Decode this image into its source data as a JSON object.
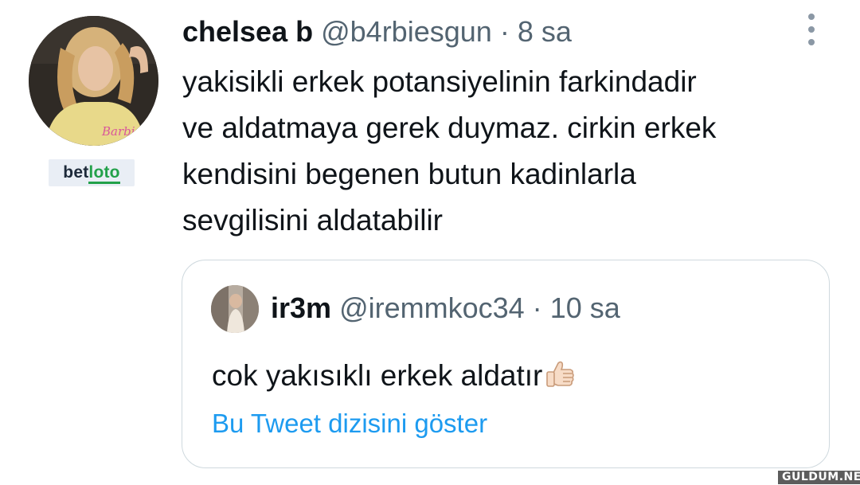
{
  "tweet": {
    "author_name": "chelsea b",
    "handle": "@b4rbiesgun",
    "separator": "·",
    "time": "8 sa",
    "text_lines": [
      "yakisikli erkek potansiyelinin farkindadir",
      "ve aldatmaya gerek duymaz. cirkin erkek",
      "kendisini begenen butun kadinlarla",
      "sevgilisini aldatabilir"
    ]
  },
  "quoted_tweet": {
    "author_name": "ir3m",
    "handle": "@iremmkoc34",
    "separator": "·",
    "time": "10 sa",
    "text": "cok yakısıklı erkek aldatır",
    "emoji": "thumbs-up-light-skin-tone",
    "show_thread_label": "Bu Tweet dizisini göster"
  },
  "watermarks": {
    "logo": "betloto",
    "site": "GULDUM.NET"
  },
  "icons": {
    "more": "more-vertical-icon",
    "emoji": "thumbs-up-icon"
  },
  "colors": {
    "text_primary": "#0f1419",
    "text_secondary": "#536471",
    "link": "#1d9bf0",
    "border": "#cfd9de"
  }
}
